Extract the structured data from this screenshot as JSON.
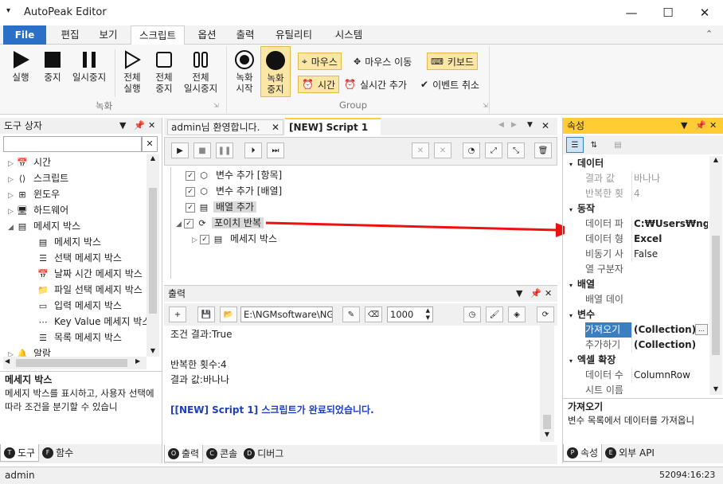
{
  "window": {
    "title": "AutoPeak Editor",
    "min": "—",
    "max": "☐",
    "close": "✕"
  },
  "ribbon_tabs": [
    "File",
    "편집",
    "보기",
    "스크립트",
    "옵션",
    "출력",
    "유틸리티",
    "시스템"
  ],
  "ribbon": {
    "record_group": {
      "label": "녹화",
      "run": "실행",
      "stop": "중지",
      "pause": "일시중지",
      "run_all": "전체\n실행",
      "stop_all": "전체\n중지",
      "pause_all": "전체\n일시중지"
    },
    "group": {
      "label": "Group",
      "rec_start": "녹화\n시작",
      "rec_stop": "녹화\n중지",
      "mouse": "마우스",
      "mouse_move": "마우스 이동",
      "keyboard": "키보드",
      "time": "시간",
      "realtime_add": "실시간 추가",
      "event_cancel": "이벤트 취소"
    }
  },
  "toolbox": {
    "title": "도구 상자",
    "search_placeholder": "",
    "items": [
      {
        "label": "시간",
        "level": 0,
        "icon": "calendar-icon",
        "ex": "▷"
      },
      {
        "label": "스크립트",
        "level": 0,
        "icon": "code-icon",
        "ex": "▷"
      },
      {
        "label": "윈도우",
        "level": 0,
        "icon": "windows-icon",
        "ex": "▷"
      },
      {
        "label": "하드웨어",
        "level": 0,
        "icon": "monitor-icon",
        "ex": "▷"
      },
      {
        "label": "메세지 박스",
        "level": 0,
        "icon": "message-icon",
        "ex": "◢"
      },
      {
        "label": "메세지 박스",
        "level": 1,
        "icon": "message-icon",
        "ex": ""
      },
      {
        "label": "선택 메세지 박스",
        "level": 1,
        "icon": "list-icon",
        "ex": ""
      },
      {
        "label": "날짜 시간 메세지 박스",
        "level": 1,
        "icon": "calendar-icon",
        "ex": ""
      },
      {
        "label": "파일 선택 메세지 박스",
        "level": 1,
        "icon": "folder-icon",
        "ex": ""
      },
      {
        "label": "입력 메세지 박스",
        "level": 1,
        "icon": "input-icon",
        "ex": ""
      },
      {
        "label": "Key Value 메세지 박스",
        "level": 1,
        "icon": "dots-icon",
        "ex": ""
      },
      {
        "label": "목록 메세지 박스",
        "level": 1,
        "icon": "list-icon",
        "ex": ""
      },
      {
        "label": "알람",
        "level": 0,
        "icon": "bell-icon",
        "ex": "▷"
      }
    ],
    "desc_title": "메세지 박스",
    "desc_text": "메세지 박스를 표시하고, 사용자 선택에 따라 조건을 분기할 수 있습니",
    "tabs": [
      "도구",
      "함수"
    ]
  },
  "editor": {
    "tabs": [
      "admin님 환영합니다.",
      "[NEW] Script 1"
    ],
    "nodes": [
      {
        "label": "변수 추가 [항목]",
        "level": 0,
        "hl": false
      },
      {
        "label": "변수 추가 [배열]",
        "level": 0,
        "hl": false
      },
      {
        "label": "배열 추가",
        "level": 0,
        "hl": true
      },
      {
        "label": "포이치 반복",
        "level": 0,
        "hl": true
      },
      {
        "label": "메세지 박스",
        "level": 1,
        "hl": false
      }
    ]
  },
  "output": {
    "title": "출력",
    "path": "E:\\NGMsoftware\\NG",
    "count": "1000",
    "lines": [
      {
        "text": "조건 결과:True",
        "c": "#222",
        "bold": false
      },
      {
        "text": "",
        "c": "#222",
        "bold": false
      },
      {
        "text": "반복한 횟수:4",
        "c": "#222",
        "bold": false
      },
      {
        "text": "결과 값:바나나",
        "c": "#222",
        "bold": false
      },
      {
        "text": "",
        "c": "#222",
        "bold": false
      },
      {
        "text": "[[NEW] Script 1] 스크립트가 완료되었습니다.",
        "c": "#1c3fbf",
        "bold": true
      }
    ],
    "tabs": [
      "출력",
      "콘솔",
      "디버그"
    ]
  },
  "properties": {
    "title": "속성",
    "rows": [
      {
        "cat": "데이터"
      },
      {
        "name": "결과 값",
        "val": "바나나",
        "gray": true
      },
      {
        "name": "반복한 횟",
        "val": "4",
        "gray": true
      },
      {
        "cat": "동작"
      },
      {
        "name": "데이터 파",
        "val": "C:₩Users₩ngma",
        "bold": true
      },
      {
        "name": "데이터 형",
        "val": "Excel",
        "bold": true
      },
      {
        "name": "비동기 사",
        "val": "False"
      },
      {
        "name": "열 구분자",
        "val": ""
      },
      {
        "cat": "배열"
      },
      {
        "name": "배열 데이",
        "val": ""
      },
      {
        "cat": "변수"
      },
      {
        "name": "가져오기",
        "val": "(Collection)",
        "bold": true,
        "sel": true
      },
      {
        "name": "추가하기",
        "val": "(Collection)",
        "bold": true
      },
      {
        "cat": "엑셀 확장"
      },
      {
        "name": "데이터 수",
        "val": "ColumnRow"
      },
      {
        "name": "시트 이름",
        "val": ""
      }
    ],
    "desc_title": "가져오기",
    "desc_text": "변수 목록에서 데이터를 가져옵니",
    "tabs": [
      "속성",
      "외부 API"
    ]
  },
  "status": {
    "user": "admin",
    "right": "52094:16:23"
  }
}
